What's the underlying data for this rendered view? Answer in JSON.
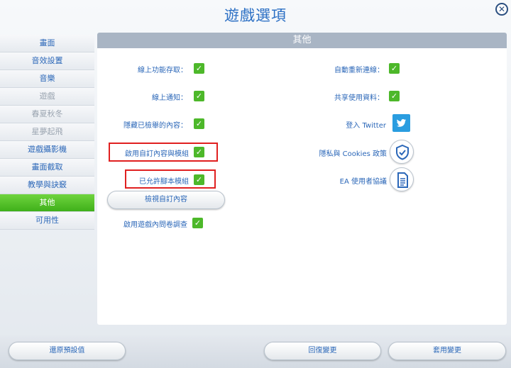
{
  "window": {
    "title": "遊戲選項",
    "close_glyph": "✕"
  },
  "sidebar": {
    "items": [
      {
        "label": "畫面",
        "state": "normal"
      },
      {
        "label": "音效設置",
        "state": "normal"
      },
      {
        "label": "音樂",
        "state": "normal"
      },
      {
        "label": "遊戲",
        "state": "disabled"
      },
      {
        "label": "春夏秋冬",
        "state": "disabled"
      },
      {
        "label": "星夢起飛",
        "state": "disabled"
      },
      {
        "label": "遊戲攝影機",
        "state": "normal"
      },
      {
        "label": "畫面截取",
        "state": "normal"
      },
      {
        "label": "教學與訣竅",
        "state": "normal"
      },
      {
        "label": "其他",
        "state": "active"
      },
      {
        "label": "可用性",
        "state": "normal"
      }
    ]
  },
  "panel": {
    "header": "其他",
    "left_options": [
      {
        "label": "線上功能存取：",
        "checked": true
      },
      {
        "label": "線上通知：",
        "checked": true
      },
      {
        "label": "隱藏已檢舉的內容：",
        "checked": true
      },
      {
        "label": "啟用自訂內容與模組",
        "checked": true
      },
      {
        "label": "已允許腳本模組",
        "checked": true
      }
    ],
    "view_custom_button": "檢視自訂內容",
    "survey_option": {
      "label": "啟用遊戲內問卷調查",
      "checked": true
    },
    "right_options": [
      {
        "label": "自動重新連線：",
        "checked": true
      },
      {
        "label": "共享使用資料：",
        "checked": true
      }
    ],
    "links": {
      "twitter": "登入 Twitter",
      "privacy": "隱私與 Cookies 政策",
      "eula": "EA 使用者協議"
    },
    "check_glyph": "✓"
  },
  "footer": {
    "restore_defaults": "還原預設值",
    "revert": "回復變更",
    "apply": "套用變更"
  },
  "colors": {
    "accent_blue": "#2b67b8",
    "check_green": "#4db82a",
    "active_tab_green": "#3fb01a",
    "highlight_red": "#e02020",
    "twitter_blue": "#2a9de0"
  }
}
